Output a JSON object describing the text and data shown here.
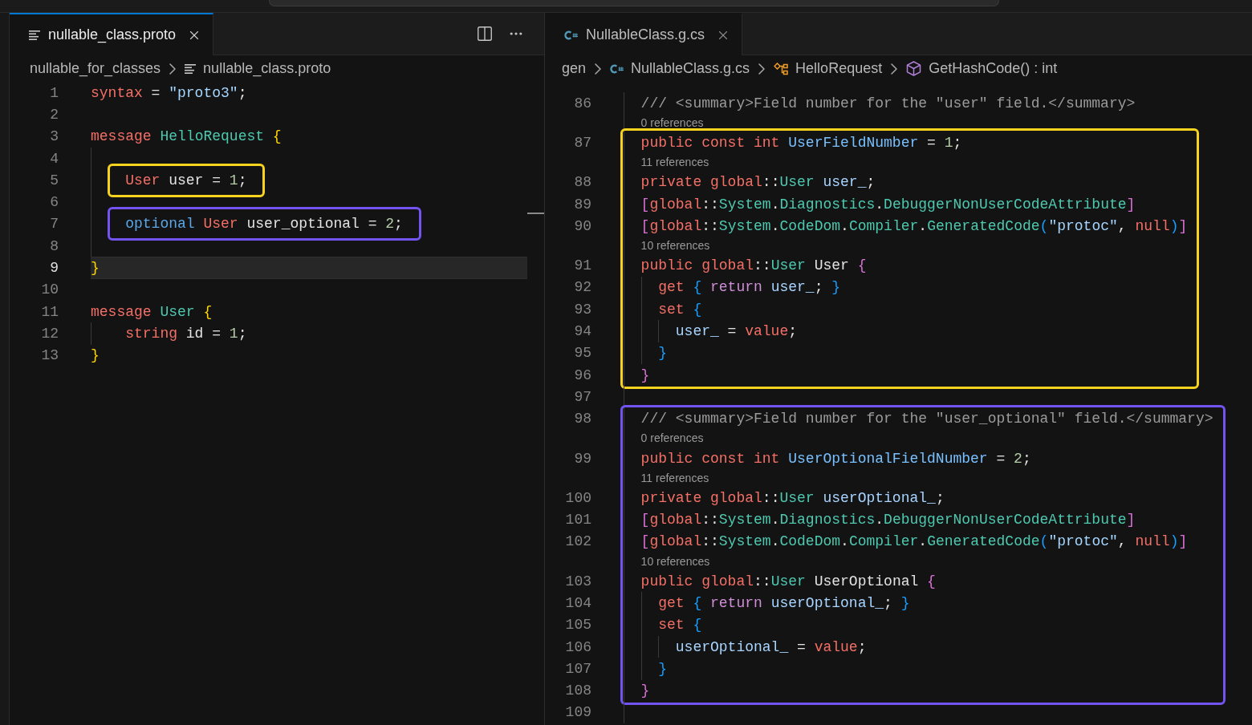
{
  "editor_groups": [
    {
      "focused": true,
      "tabs": [
        {
          "kind": "proto",
          "label": "nullable_class.proto",
          "selected": true
        }
      ],
      "breadcrumbs": [
        {
          "kind": "folder",
          "label": "nullable_for_classes"
        },
        {
          "kind": "proto",
          "label": "nullable_class.proto"
        }
      ],
      "lines": [
        {
          "kind": "code",
          "number": "1",
          "current": false,
          "tokens": [
            {
              "kind": "keyword",
              "text": "syntax"
            },
            {
              "kind": "plain",
              "text": " = "
            },
            {
              "kind": "string",
              "text": "\"proto3\""
            },
            {
              "kind": "plain",
              "text": ";"
            }
          ]
        },
        {
          "kind": "code",
          "number": "2",
          "current": false
        },
        {
          "kind": "code",
          "number": "3",
          "current": false,
          "tokens": [
            {
              "kind": "keyword",
              "text": "message "
            },
            {
              "kind": "type",
              "text": "HelloRequest "
            },
            {
              "kind": "bracket_yellow",
              "text": "{"
            }
          ],
          "children": [
            {
              "kind": "code",
              "number": "4",
              "current": false
            },
            {
              "kind": "code",
              "number": "5",
              "current": false,
              "highlight": {
                "color": "#f6d31f"
              },
              "tokens": [
                {
                  "kind": "keyword",
                  "text": "User"
                },
                {
                  "kind": "plain",
                  "text": " user = "
                },
                {
                  "kind": "number",
                  "text": "1"
                },
                {
                  "kind": "plain",
                  "text": ";"
                }
              ]
            },
            {
              "kind": "code",
              "number": "6",
              "current": false
            },
            {
              "kind": "code",
              "number": "7",
              "current": false,
              "highlight": {
                "color": "#7354f0"
              },
              "tokens": [
                {
                  "kind": "modifier",
                  "text": "optional "
                },
                {
                  "kind": "keyword",
                  "text": "User"
                },
                {
                  "kind": "plain",
                  "text": " user_optional = "
                },
                {
                  "kind": "number",
                  "text": "2"
                },
                {
                  "kind": "plain",
                  "text": ";"
                }
              ]
            },
            {
              "kind": "code",
              "number": "8",
              "current": false
            }
          ]
        },
        {
          "kind": "code",
          "number": "9",
          "current": true,
          "tokens": [
            {
              "kind": "bracket_yellow",
              "text": "}"
            }
          ]
        },
        {
          "kind": "code",
          "number": "10",
          "current": false
        },
        {
          "kind": "code",
          "number": "11",
          "current": false,
          "tokens": [
            {
              "kind": "keyword",
              "text": "message "
            },
            {
              "kind": "type",
              "text": "User "
            },
            {
              "kind": "bracket_yellow",
              "text": "{"
            }
          ],
          "children": [
            {
              "kind": "code",
              "number": "12",
              "current": false,
              "tokens": [
                {
                  "kind": "keyword",
                  "text": "string"
                },
                {
                  "kind": "plain",
                  "text": " id = "
                },
                {
                  "kind": "number",
                  "text": "1"
                },
                {
                  "kind": "plain",
                  "text": ";"
                }
              ]
            }
          ]
        },
        {
          "kind": "code",
          "number": "13",
          "current": false,
          "tokens": [
            {
              "kind": "bracket_yellow",
              "text": "}"
            }
          ]
        }
      ]
    },
    {
      "focused": false,
      "tabs": [
        {
          "kind": "csharp",
          "label": "NullableClass.g.cs",
          "selected": true
        }
      ],
      "breadcrumbs": [
        {
          "kind": "folder",
          "label": "gen"
        },
        {
          "kind": "csharp",
          "label": "NullableClass.g.cs"
        },
        {
          "kind": "class",
          "label": "HelloRequest"
        },
        {
          "kind": "method",
          "label": "GetHashCode() : int"
        }
      ],
      "lines": [
        {
          "kind": "code",
          "number": "86",
          "current": false,
          "tokens": [
            {
              "kind": "comment",
              "text": "/// <summary>Field number for the \"user\" field.</summary>"
            }
          ]
        },
        {
          "kind": "lens",
          "text": "0 references"
        },
        {
          "kind": "highlight",
          "color": "#f6d31f",
          "lines": [
            {
              "kind": "code",
              "number": "87",
              "current": false,
              "tokens": [
                {
                  "kind": "keyword",
                  "text": "public const int "
                },
                {
                  "kind": "constant",
                  "text": "UserFieldNumber"
                },
                {
                  "kind": "plain",
                  "text": " = "
                },
                {
                  "kind": "number",
                  "text": "1"
                },
                {
                  "kind": "plain",
                  "text": ";"
                }
              ]
            },
            {
              "kind": "lens",
              "text": "11 references"
            },
            {
              "kind": "code",
              "number": "88",
              "current": false,
              "tokens": [
                {
                  "kind": "keyword",
                  "text": "private global"
                },
                {
                  "kind": "plain",
                  "text": "::"
                },
                {
                  "kind": "type",
                  "text": "User "
                },
                {
                  "kind": "variable",
                  "text": "user_"
                },
                {
                  "kind": "plain",
                  "text": ";"
                }
              ]
            },
            {
              "kind": "code",
              "number": "89",
              "current": false,
              "tokens": [
                {
                  "kind": "bracket_pink",
                  "text": "["
                },
                {
                  "kind": "keyword",
                  "text": "global"
                },
                {
                  "kind": "plain",
                  "text": "::"
                },
                {
                  "kind": "type",
                  "text": "System"
                },
                {
                  "kind": "plain",
                  "text": "."
                },
                {
                  "kind": "type",
                  "text": "Diagnostics"
                },
                {
                  "kind": "plain",
                  "text": "."
                },
                {
                  "kind": "type",
                  "text": "DebuggerNonUserCodeAttribute"
                },
                {
                  "kind": "bracket_pink",
                  "text": "]"
                }
              ]
            },
            {
              "kind": "code",
              "number": "90",
              "current": false,
              "tokens": [
                {
                  "kind": "bracket_pink",
                  "text": "["
                },
                {
                  "kind": "keyword",
                  "text": "global"
                },
                {
                  "kind": "plain",
                  "text": "::"
                },
                {
                  "kind": "type",
                  "text": "System"
                },
                {
                  "kind": "plain",
                  "text": "."
                },
                {
                  "kind": "type",
                  "text": "CodeDom"
                },
                {
                  "kind": "plain",
                  "text": "."
                },
                {
                  "kind": "type",
                  "text": "Compiler"
                },
                {
                  "kind": "plain",
                  "text": "."
                },
                {
                  "kind": "type",
                  "text": "GeneratedCode"
                },
                {
                  "kind": "bracket_blue",
                  "text": "("
                },
                {
                  "kind": "string",
                  "text": "\"protoc\""
                },
                {
                  "kind": "plain",
                  "text": ", "
                },
                {
                  "kind": "keyword",
                  "text": "null"
                },
                {
                  "kind": "bracket_blue",
                  "text": ")"
                },
                {
                  "kind": "bracket_pink",
                  "text": "]"
                }
              ]
            },
            {
              "kind": "lens",
              "text": "10 references"
            },
            {
              "kind": "code",
              "number": "91",
              "current": false,
              "tokens": [
                {
                  "kind": "keyword",
                  "text": "public global"
                },
                {
                  "kind": "plain",
                  "text": "::"
                },
                {
                  "kind": "type",
                  "text": "User"
                },
                {
                  "kind": "plain",
                  "text": " User "
                },
                {
                  "kind": "bracket_pink",
                  "text": "{"
                }
              ],
              "children": [
                {
                  "kind": "code",
                  "number": "92",
                  "current": false,
                  "tokens": [
                    {
                      "kind": "keyword",
                      "text": "get "
                    },
                    {
                      "kind": "bracket_blue",
                      "text": "{ "
                    },
                    {
                      "kind": "control",
                      "text": "return "
                    },
                    {
                      "kind": "variable",
                      "text": "user_"
                    },
                    {
                      "kind": "plain",
                      "text": "; "
                    },
                    {
                      "kind": "bracket_blue",
                      "text": "}"
                    }
                  ]
                },
                {
                  "kind": "code",
                  "number": "93",
                  "current": false,
                  "tokens": [
                    {
                      "kind": "keyword",
                      "text": "set "
                    },
                    {
                      "kind": "bracket_blue",
                      "text": "{"
                    }
                  ],
                  "children": [
                    {
                      "kind": "code",
                      "number": "94",
                      "current": false,
                      "tokens": [
                        {
                          "kind": "variable",
                          "text": "user_"
                        },
                        {
                          "kind": "plain",
                          "text": " = "
                        },
                        {
                          "kind": "keyword",
                          "text": "value"
                        },
                        {
                          "kind": "plain",
                          "text": ";"
                        }
                      ]
                    }
                  ]
                },
                {
                  "kind": "code",
                  "number": "95",
                  "current": false,
                  "tokens": [
                    {
                      "kind": "bracket_blue",
                      "text": "}"
                    }
                  ]
                }
              ]
            },
            {
              "kind": "code",
              "number": "96",
              "current": false,
              "tokens": [
                {
                  "kind": "bracket_pink",
                  "text": "}"
                }
              ]
            }
          ]
        },
        {
          "kind": "code",
          "number": "97",
          "current": false
        },
        {
          "kind": "highlight",
          "color": "#7354f0",
          "lines": [
            {
              "kind": "code",
              "number": "98",
              "current": false,
              "tokens": [
                {
                  "kind": "comment",
                  "text": "/// <summary>Field number for the \"user_optional\" field.</summary>"
                }
              ]
            },
            {
              "kind": "lens",
              "text": "0 references"
            },
            {
              "kind": "code",
              "number": "99",
              "current": false,
              "tokens": [
                {
                  "kind": "keyword",
                  "text": "public const int "
                },
                {
                  "kind": "constant",
                  "text": "UserOptionalFieldNumber"
                },
                {
                  "kind": "plain",
                  "text": " = "
                },
                {
                  "kind": "number",
                  "text": "2"
                },
                {
                  "kind": "plain",
                  "text": ";"
                }
              ]
            },
            {
              "kind": "lens",
              "text": "11 references"
            },
            {
              "kind": "code",
              "number": "100",
              "current": false,
              "tokens": [
                {
                  "kind": "keyword",
                  "text": "private global"
                },
                {
                  "kind": "plain",
                  "text": "::"
                },
                {
                  "kind": "type",
                  "text": "User "
                },
                {
                  "kind": "variable",
                  "text": "userOptional_"
                },
                {
                  "kind": "plain",
                  "text": ";"
                }
              ]
            },
            {
              "kind": "code",
              "number": "101",
              "current": false,
              "tokens": [
                {
                  "kind": "bracket_pink",
                  "text": "["
                },
                {
                  "kind": "keyword",
                  "text": "global"
                },
                {
                  "kind": "plain",
                  "text": "::"
                },
                {
                  "kind": "type",
                  "text": "System"
                },
                {
                  "kind": "plain",
                  "text": "."
                },
                {
                  "kind": "type",
                  "text": "Diagnostics"
                },
                {
                  "kind": "plain",
                  "text": "."
                },
                {
                  "kind": "type",
                  "text": "DebuggerNonUserCodeAttribute"
                },
                {
                  "kind": "bracket_pink",
                  "text": "]"
                }
              ]
            },
            {
              "kind": "code",
              "number": "102",
              "current": false,
              "tokens": [
                {
                  "kind": "bracket_pink",
                  "text": "["
                },
                {
                  "kind": "keyword",
                  "text": "global"
                },
                {
                  "kind": "plain",
                  "text": "::"
                },
                {
                  "kind": "type",
                  "text": "System"
                },
                {
                  "kind": "plain",
                  "text": "."
                },
                {
                  "kind": "type",
                  "text": "CodeDom"
                },
                {
                  "kind": "plain",
                  "text": "."
                },
                {
                  "kind": "type",
                  "text": "Compiler"
                },
                {
                  "kind": "plain",
                  "text": "."
                },
                {
                  "kind": "type",
                  "text": "GeneratedCode"
                },
                {
                  "kind": "bracket_blue",
                  "text": "("
                },
                {
                  "kind": "string",
                  "text": "\"protoc\""
                },
                {
                  "kind": "plain",
                  "text": ", "
                },
                {
                  "kind": "keyword",
                  "text": "null"
                },
                {
                  "kind": "bracket_blue",
                  "text": ")"
                },
                {
                  "kind": "bracket_pink",
                  "text": "]"
                }
              ]
            },
            {
              "kind": "lens",
              "text": "10 references"
            },
            {
              "kind": "code",
              "number": "103",
              "current": false,
              "tokens": [
                {
                  "kind": "keyword",
                  "text": "public global"
                },
                {
                  "kind": "plain",
                  "text": "::"
                },
                {
                  "kind": "type",
                  "text": "User"
                },
                {
                  "kind": "plain",
                  "text": " UserOptional "
                },
                {
                  "kind": "bracket_pink",
                  "text": "{"
                }
              ],
              "children": [
                {
                  "kind": "code",
                  "number": "104",
                  "current": false,
                  "tokens": [
                    {
                      "kind": "keyword",
                      "text": "get "
                    },
                    {
                      "kind": "bracket_blue",
                      "text": "{ "
                    },
                    {
                      "kind": "control",
                      "text": "return "
                    },
                    {
                      "kind": "variable",
                      "text": "userOptional_"
                    },
                    {
                      "kind": "plain",
                      "text": "; "
                    },
                    {
                      "kind": "bracket_blue",
                      "text": "}"
                    }
                  ]
                },
                {
                  "kind": "code",
                  "number": "105",
                  "current": false,
                  "tokens": [
                    {
                      "kind": "keyword",
                      "text": "set "
                    },
                    {
                      "kind": "bracket_blue",
                      "text": "{"
                    }
                  ],
                  "children": [
                    {
                      "kind": "code",
                      "number": "106",
                      "current": false,
                      "tokens": [
                        {
                          "kind": "variable",
                          "text": "userOptional_"
                        },
                        {
                          "kind": "plain",
                          "text": " = "
                        },
                        {
                          "kind": "keyword",
                          "text": "value"
                        },
                        {
                          "kind": "plain",
                          "text": ";"
                        }
                      ]
                    }
                  ]
                },
                {
                  "kind": "code",
                  "number": "107",
                  "current": false,
                  "tokens": [
                    {
                      "kind": "bracket_blue",
                      "text": "}"
                    }
                  ]
                }
              ]
            },
            {
              "kind": "code",
              "number": "108",
              "current": false,
              "tokens": [
                {
                  "kind": "bracket_pink",
                  "text": "}"
                }
              ]
            }
          ]
        },
        {
          "kind": "code",
          "number": "109",
          "current": false
        }
      ]
    }
  ]
}
